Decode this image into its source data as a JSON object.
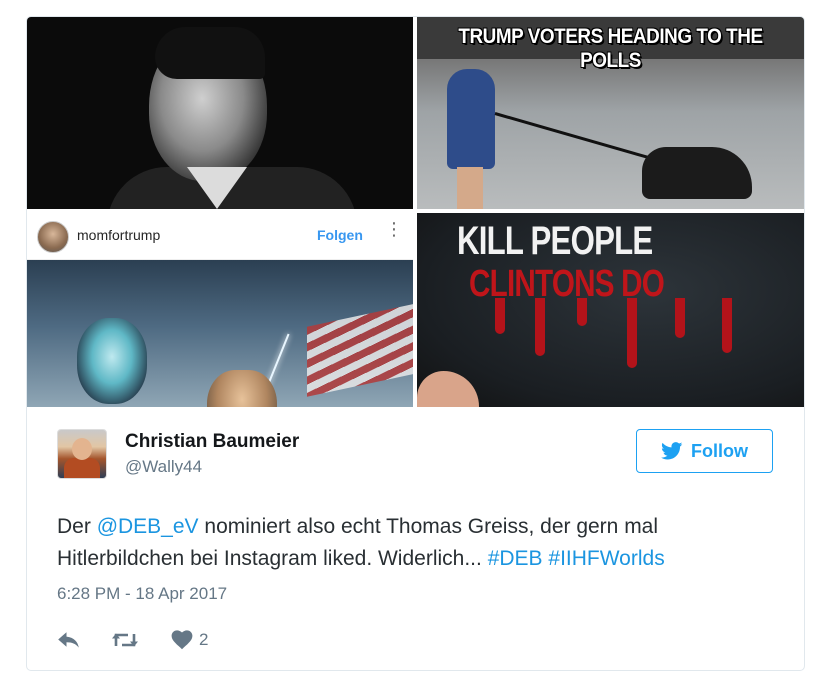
{
  "media": {
    "top_right_caption": "TRUMP VOTERS HEADING TO THE POLLS",
    "instagram_username": "momfortrump",
    "instagram_follow": "Folgen",
    "instagram_more": "⋮",
    "shirt_line1": "KILL PEOPLE",
    "shirt_line2": "CLINTONS DO"
  },
  "tweet": {
    "author_name": "Christian Baumeier",
    "author_handle": "@Wally44",
    "follow_label": "Follow",
    "text_part1": "Der ",
    "mention": "@DEB_eV",
    "text_part2": " nominiert also echt Thomas Greiss, der gern mal Hitlerbildchen bei Instagram liked. Widerlich... ",
    "hashtag1": "#DEB",
    "text_space": " ",
    "hashtag2": "#IIHFWorlds",
    "timestamp": "6:28 PM - 18 Apr 2017",
    "like_count": "2"
  },
  "colors": {
    "link": "#1b95e0",
    "follow_blue": "#1da1f2",
    "muted_text": "#657786",
    "body_text": "#292f33",
    "border": "#e1e8ed"
  },
  "icons": {
    "follow": "twitter-bird-icon",
    "reply": "reply-icon",
    "retweet": "retweet-icon",
    "like": "heart-icon"
  }
}
